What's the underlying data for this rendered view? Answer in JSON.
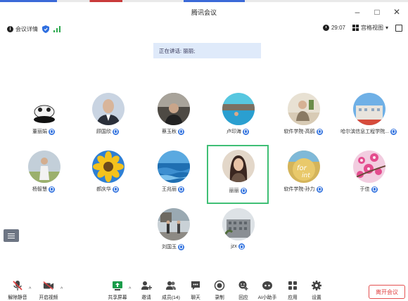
{
  "window": {
    "title": "腾讯会议",
    "minimize": "–",
    "maximize": "□",
    "close": "✕"
  },
  "infobar": {
    "meeting_details": "会议详情",
    "timer": "29:07",
    "view_mode": "宫格视图",
    "view_caret": "▾"
  },
  "speaking": {
    "text": "正在讲话: 丽丽;"
  },
  "participants": [
    {
      "name": "董丽娟"
    },
    {
      "name": "顾国欣"
    },
    {
      "name": "蔡玉秋"
    },
    {
      "name": "卢印海"
    },
    {
      "name": "软件学院-高鸥"
    },
    {
      "name": "哈尔滨信息工程学院..."
    },
    {
      "name": "杨智慧"
    },
    {
      "name": "郝庆华"
    },
    {
      "name": "王兆丽"
    },
    {
      "name": "丽丽"
    },
    {
      "name": "软件学院-孙力"
    },
    {
      "name": "于佳"
    },
    {
      "name": "刘国玉"
    },
    {
      "name": "jzx"
    }
  ],
  "toolbar": {
    "unmute": "解除静音",
    "start_video": "开启视频",
    "share_screen": "共享屏幕",
    "invite": "邀请",
    "members": "成员(14)",
    "chat": "聊天",
    "record": "录制",
    "reaction": "回应",
    "ai_assistant": "AI小助手",
    "apps": "应用",
    "settings": "设置",
    "caret": "^",
    "leave": "离开会议"
  },
  "colors": {
    "accent": "#3a78e0",
    "active_outline": "#3fbf75",
    "leave": "#e04040"
  }
}
